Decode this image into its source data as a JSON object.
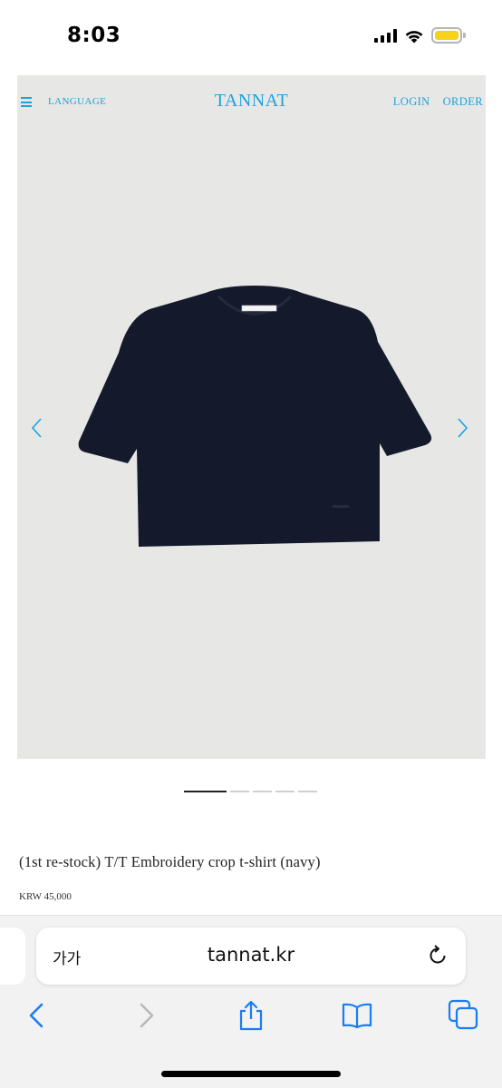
{
  "status_bar": {
    "time": "8:03",
    "icons": [
      "cellular-signal-icon",
      "wifi-icon",
      "battery-low-power-icon"
    ],
    "battery_color": "#f7d21b"
  },
  "site": {
    "menu_icon": "hamburger-menu-icon",
    "language_label": "LANGUAGE",
    "logo": "TANNAT",
    "login_label": "LOGIN",
    "order_label": "ORDER",
    "accent_color": "#1aa3e0"
  },
  "gallery": {
    "background_color": "#e7e7e5",
    "item_color": "#141a2b",
    "slide_count": 5,
    "active_slide": 1,
    "prev_icon": "chevron-left-icon",
    "next_icon": "chevron-right-icon"
  },
  "product": {
    "title": "(1st re-stock) T/T Embroidery crop t-shirt (navy)",
    "price": "KRW 45,000"
  },
  "browser": {
    "text_size_label": "가가",
    "url": "tannat.kr",
    "reload_icon": "reload-icon",
    "toolbar": [
      "back-icon",
      "forward-icon",
      "share-icon",
      "bookmarks-icon",
      "tabs-icon"
    ],
    "tint_color": "#1a7cf5"
  }
}
